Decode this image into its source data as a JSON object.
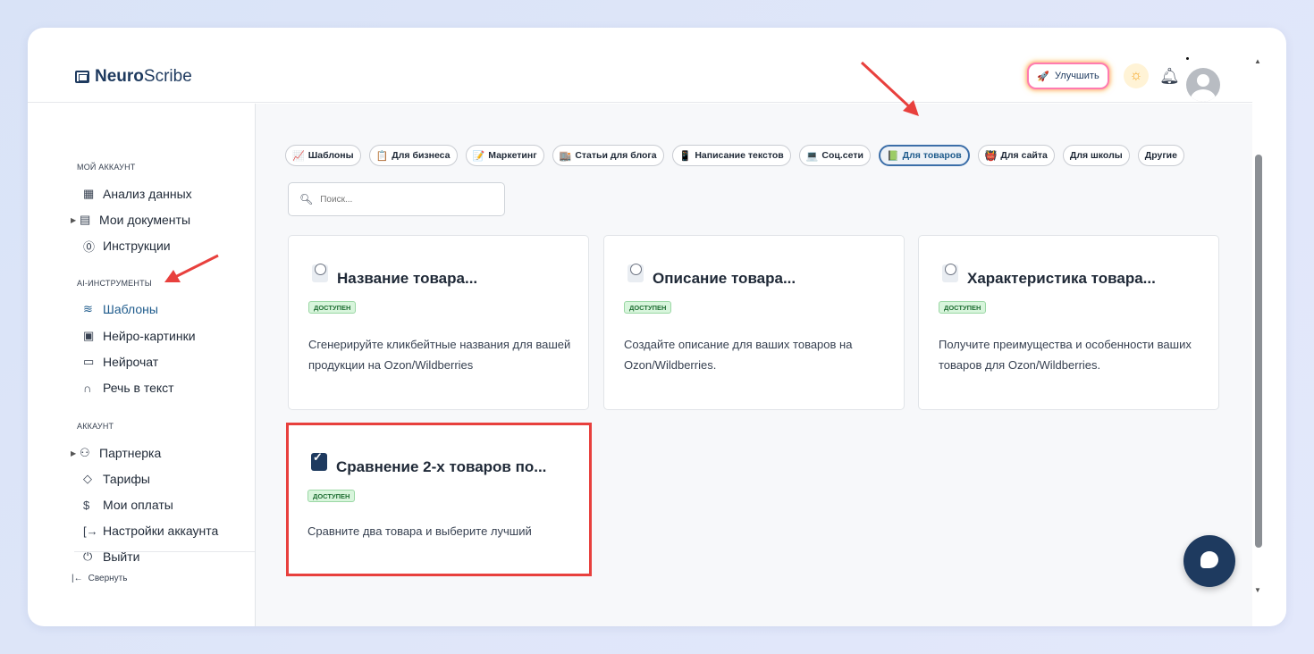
{
  "header": {
    "logo_bold": "Neuro",
    "logo_rest": "Scribe",
    "upgrade_label": "Улучшить"
  },
  "sidebar": {
    "section_account": "МОЙ АККАУНТ",
    "items_account": [
      {
        "label": "Анализ данных",
        "icon": "grid-icon"
      },
      {
        "label": "Мои документы",
        "icon": "document-icon"
      },
      {
        "label": "Инструкции",
        "icon": "help-circle-icon"
      }
    ],
    "section_ai": "AI-ИНСТРУМЕНТЫ",
    "items_ai": [
      {
        "label": "Шаблоны",
        "icon": "layers-icon"
      },
      {
        "label": "Нейро-картинки",
        "icon": "image-icon"
      },
      {
        "label": "Нейрочат",
        "icon": "chat-icon"
      },
      {
        "label": "Речь в текст",
        "icon": "headphones-icon"
      }
    ],
    "section_acc2": "АККАУНТ",
    "items_acc2": [
      {
        "label": "Партнерка",
        "icon": "users-icon"
      },
      {
        "label": "Тарифы",
        "icon": "tag-icon"
      },
      {
        "label": "Мои оплаты",
        "icon": "dollar-icon"
      },
      {
        "label": "Настройки аккаунта",
        "icon": "login-icon"
      },
      {
        "label": "Выйти",
        "icon": "power-icon"
      }
    ],
    "collapse_label": "Свернуть"
  },
  "chips": [
    {
      "label": "Шаблоны",
      "icon": "📈"
    },
    {
      "label": "Для бизнеса",
      "icon": "📋"
    },
    {
      "label": "Маркетинг",
      "icon": "📝"
    },
    {
      "label": "Статьи для блога",
      "icon": "🏬"
    },
    {
      "label": "Написание текстов",
      "icon": "📱"
    },
    {
      "label": "Соц.сети",
      "icon": "💻"
    },
    {
      "label": "Для товаров",
      "icon": "📗"
    },
    {
      "label": "Для сайта",
      "icon": "👹"
    },
    {
      "label": "Для школы",
      "icon": ""
    },
    {
      "label": "Другие",
      "icon": ""
    }
  ],
  "active_chip": "Для товаров",
  "search": {
    "placeholder": "Поиск..."
  },
  "cards": [
    {
      "title": "Название товара...",
      "badge": "ДОСТУПЕН",
      "description": "Сгенерируйте кликбейтные названия для вашей продукции на Ozon/Wildberries"
    },
    {
      "title": "Описание товара...",
      "badge": "ДОСТУПЕН",
      "description": "Создайте описание для ваших товаров на Ozon/Wildberries."
    },
    {
      "title": "Характеристика товара...",
      "badge": "ДОСТУПЕН",
      "description": "Получите преимущества и особенности ваших товаров для Ozon/Wildberries."
    },
    {
      "title": "Сравнение 2-х товаров по...",
      "badge": "ДОСТУПЕН",
      "description": "Сравните два товара и выберите лучший"
    }
  ],
  "colors": {
    "accent": "#1e3a5f",
    "active": "#1e5b8c",
    "badge_bg": "#d8f5dc",
    "highlight": "#e8403d"
  }
}
